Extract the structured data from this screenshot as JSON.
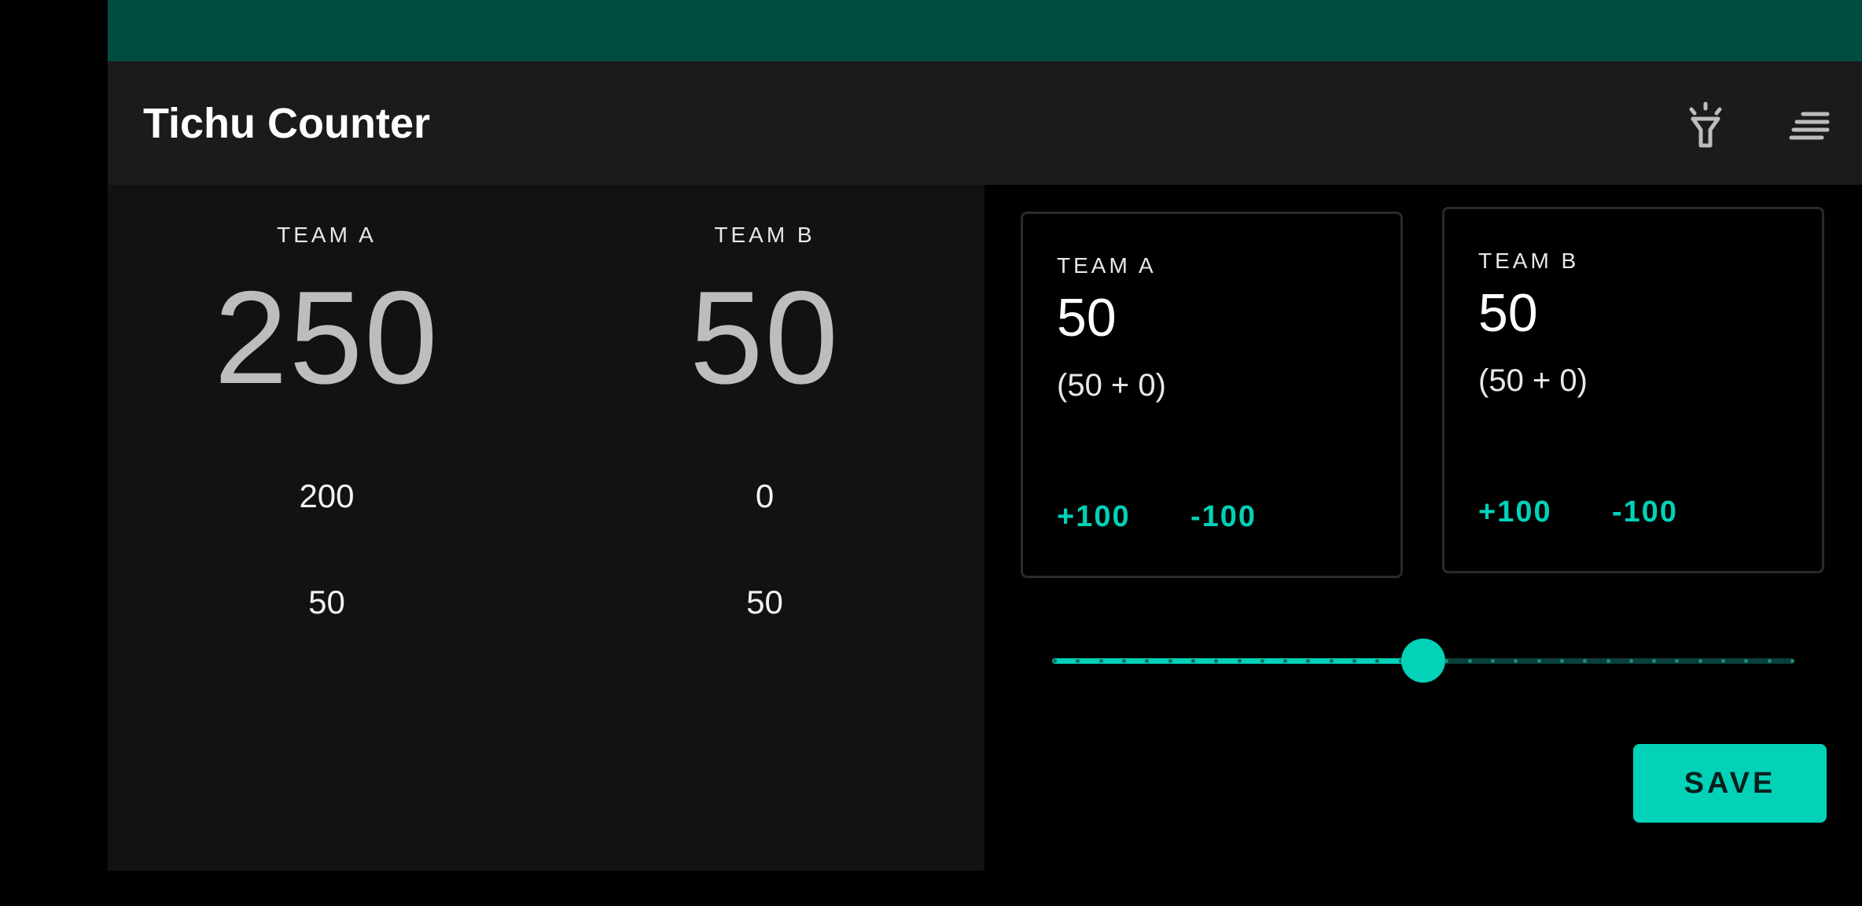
{
  "app": {
    "title": "Tichu Counter"
  },
  "toolbar": {
    "flashlight_icon": "flashlight-icon",
    "menu_icon": "menu-icon"
  },
  "scoreboard": {
    "team_a": {
      "label": "TEAM A",
      "total": "250",
      "rounds": [
        "200",
        "50"
      ]
    },
    "team_b": {
      "label": "TEAM B",
      "total": "50",
      "rounds": [
        "0",
        "50"
      ]
    }
  },
  "round_input": {
    "team_a": {
      "label": "TEAM A",
      "score": "50",
      "breakdown": "(50 + 0)",
      "plus_label": "+100",
      "minus_label": "-100"
    },
    "team_b": {
      "label": "TEAM B",
      "score": "50",
      "breakdown": "(50 + 0)",
      "plus_label": "+100",
      "minus_label": "-100"
    }
  },
  "slider": {
    "steps": 32,
    "value_fraction": 0.5
  },
  "save_label": "SAVE",
  "colors": {
    "accent": "#03d1b8",
    "status_bar": "#004d40",
    "app_bar": "#1b1b1b",
    "pane": "#121212"
  }
}
